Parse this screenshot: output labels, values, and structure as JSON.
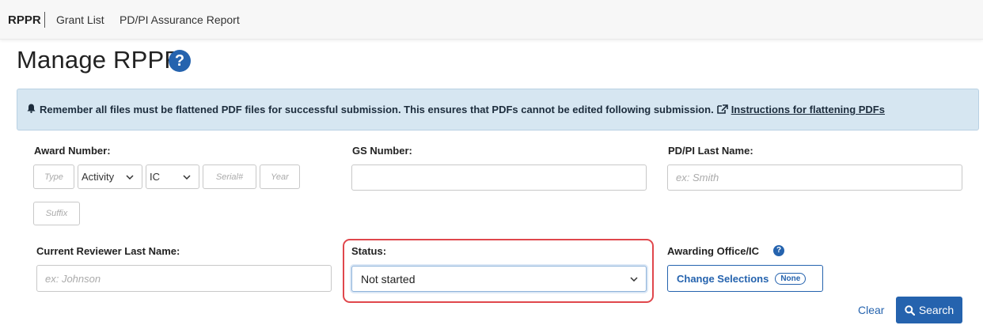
{
  "nav": {
    "brand": "RPPR",
    "links": [
      "Grant List",
      "PD/PI Assurance Report"
    ]
  },
  "page": {
    "title": "Manage RPPR",
    "help_icon": "question-circle-icon"
  },
  "alert": {
    "icon": "bell-icon",
    "message": "Remember all files must be flattened PDF files for successful submission. This ensures that PDFs cannot be edited following submission.",
    "link_icon": "external-link-icon",
    "link_text": "Instructions for flattening PDFs"
  },
  "form": {
    "award_number": {
      "label": "Award Number:",
      "type_placeholder": "Type",
      "activity_value": "Activity",
      "ic_value": "IC",
      "serial_placeholder": "Serial#",
      "year_placeholder": "Year",
      "suffix_placeholder": "Suffix"
    },
    "gs_number": {
      "label": "GS Number:",
      "value": ""
    },
    "pdpi_last_name": {
      "label": "PD/PI Last Name:",
      "placeholder": "ex: Smith"
    },
    "reviewer_last_name": {
      "label": "Current Reviewer Last Name:",
      "placeholder": "ex: Johnson"
    },
    "status": {
      "label": "Status:",
      "value": "Not started"
    },
    "awarding_office": {
      "label": "Awarding Office/IC",
      "button_label": "Change Selections",
      "badge": "None"
    }
  },
  "actions": {
    "clear": "Clear",
    "search": "Search"
  },
  "colors": {
    "primary": "#2563ae",
    "alert_bg": "#d6e6f1",
    "highlight": "#e0474c"
  }
}
